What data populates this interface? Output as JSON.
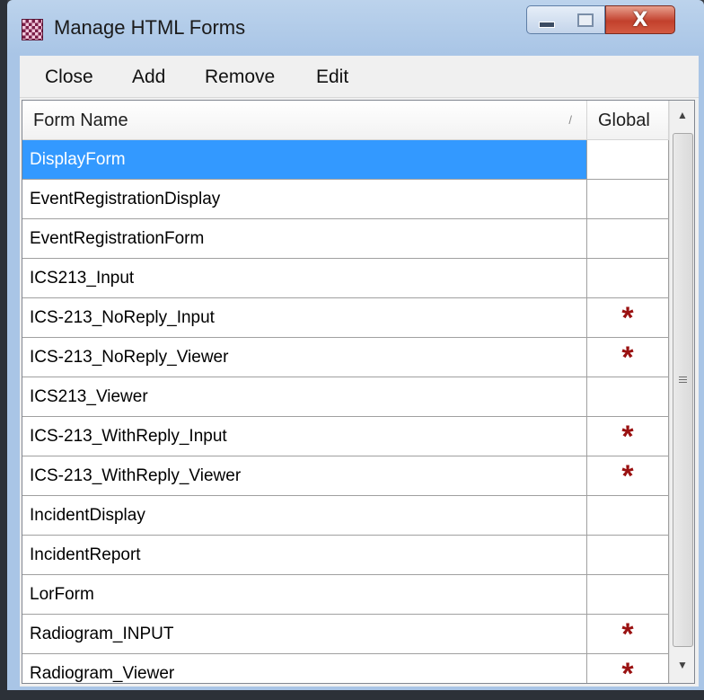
{
  "window": {
    "title": "Manage HTML Forms",
    "close_glyph": "X"
  },
  "menu": {
    "close": "Close",
    "add": "Add",
    "remove": "Remove",
    "edit": "Edit"
  },
  "grid": {
    "columns": [
      "Form Name",
      "Global"
    ],
    "sort_indicator": "/",
    "rows": [
      {
        "name": "DisplayForm",
        "global": "",
        "selected": true
      },
      {
        "name": "EventRegistrationDisplay",
        "global": ""
      },
      {
        "name": "EventRegistrationForm",
        "global": ""
      },
      {
        "name": "ICS213_Input",
        "global": ""
      },
      {
        "name": "ICS-213_NoReply_Input",
        "global": "*"
      },
      {
        "name": "ICS-213_NoReply_Viewer",
        "global": "*"
      },
      {
        "name": "ICS213_Viewer",
        "global": ""
      },
      {
        "name": "ICS-213_WithReply_Input",
        "global": "*"
      },
      {
        "name": "ICS-213_WithReply_Viewer",
        "global": "*"
      },
      {
        "name": "IncidentDisplay",
        "global": ""
      },
      {
        "name": "IncidentReport",
        "global": ""
      },
      {
        "name": "LorForm",
        "global": ""
      },
      {
        "name": "Radiogram_INPUT",
        "global": "*"
      },
      {
        "name": "Radiogram_Viewer",
        "global": "*"
      }
    ]
  },
  "scrollbar": {
    "up_glyph": "▲",
    "down_glyph": "▼"
  },
  "colors": {
    "selection": "#3399ff",
    "global_marker": "#9a1111"
  }
}
